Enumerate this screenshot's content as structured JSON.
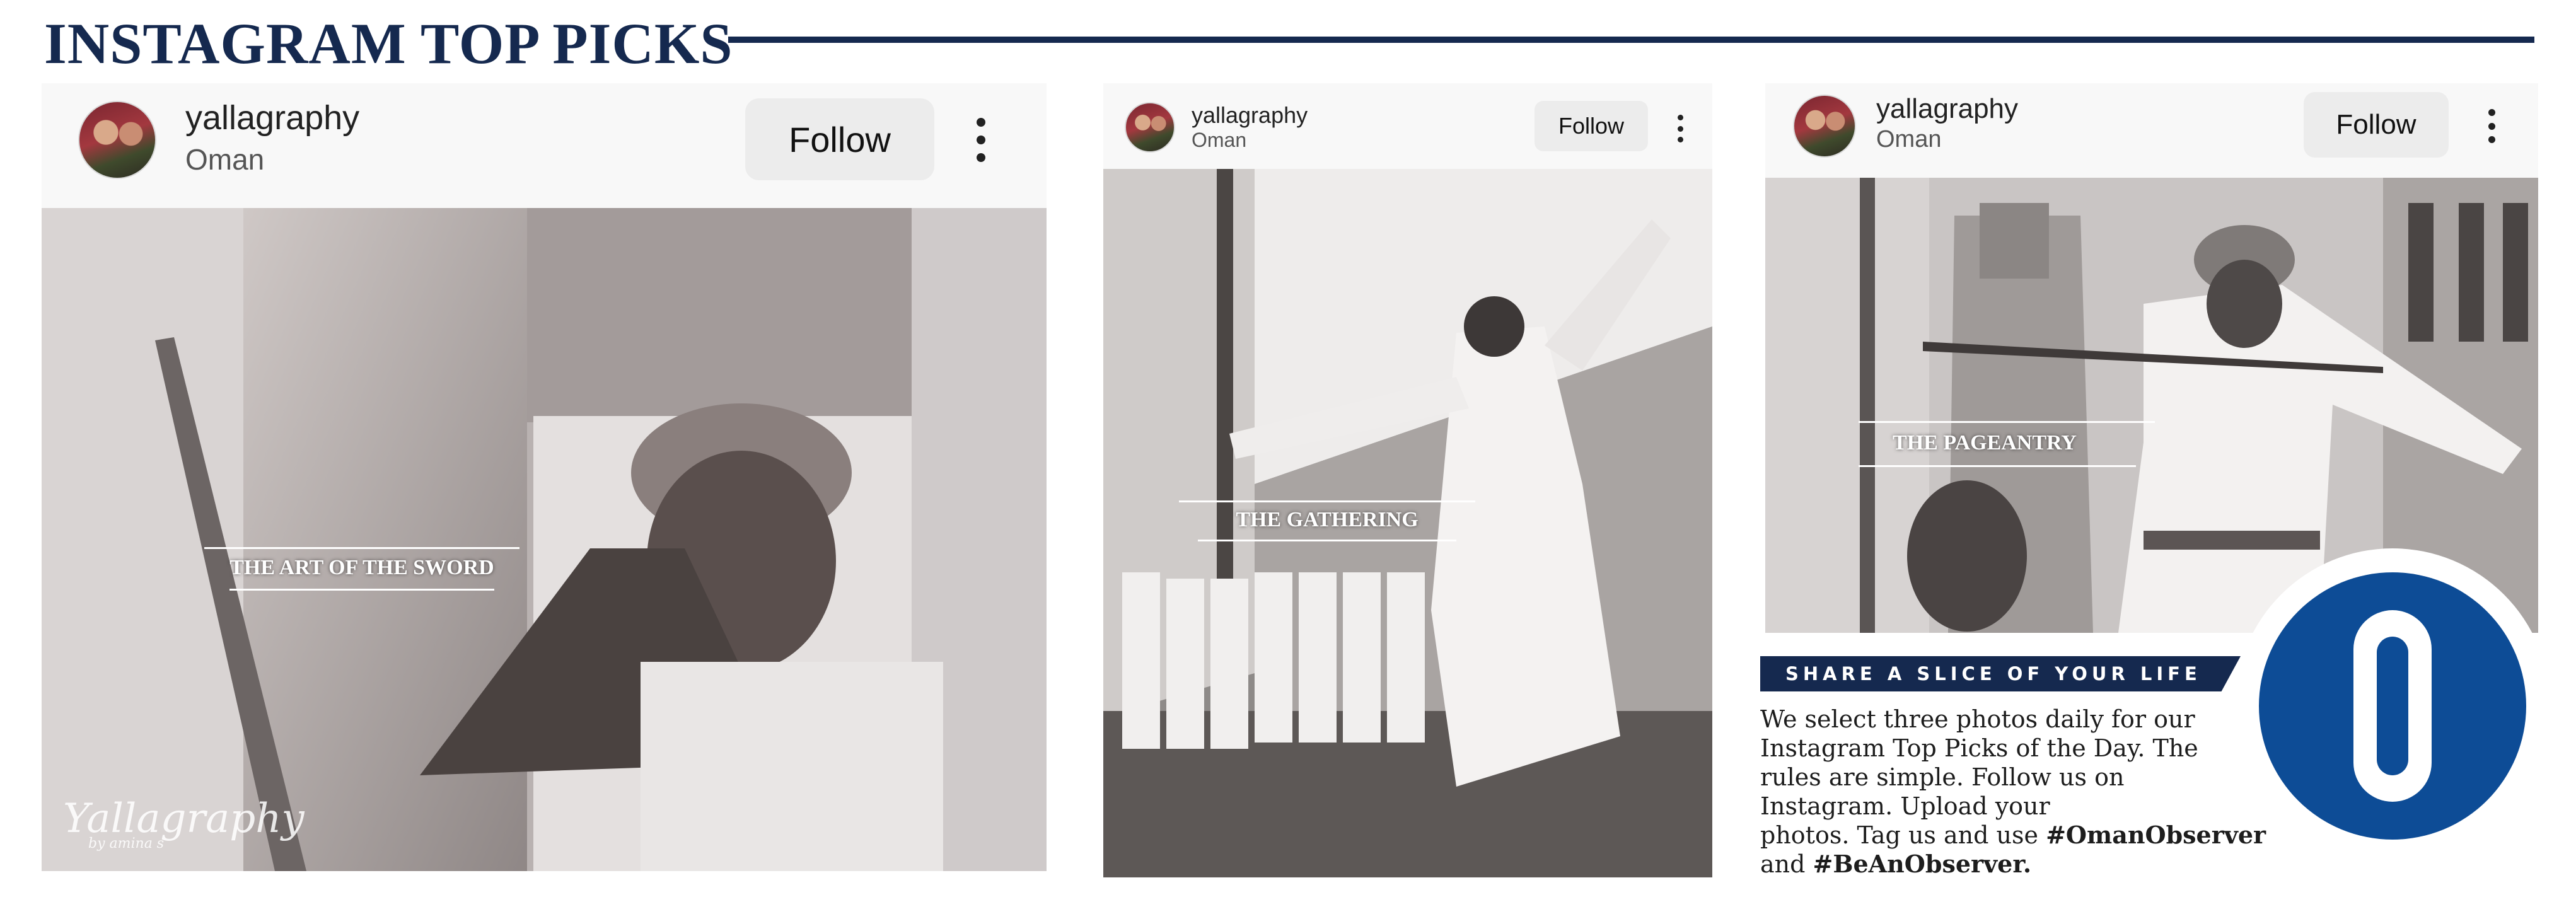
{
  "header": {
    "title": "INSTAGRAM TOP PICKS"
  },
  "posts": [
    {
      "username": "yallagraphy",
      "location": "Oman",
      "follow_label": "Follow",
      "photo_caption": "THE ART OF THE SWORD",
      "watermark": "Yallagraphy",
      "watermark_sub": "by amina s"
    },
    {
      "username": "yallagraphy",
      "location": "Oman",
      "follow_label": "Follow",
      "photo_caption": "THE GATHERING"
    },
    {
      "username": "yallagraphy",
      "location": "Oman",
      "follow_label": "Follow",
      "photo_caption": "THE PAGEANTRY"
    }
  ],
  "info": {
    "banner": "SHARE A SLICE OF YOUR LIFE",
    "lines": [
      "We select three photos daily for our",
      "Instagram Top Picks of the Day. The",
      "rules are simple. Follow us on",
      "Instagram. Upload your"
    ],
    "line5_text": "photos. Tag us and use ",
    "hashtag1": "#OmanObserver",
    "line6_text": "and ",
    "hashtag2": "#BeAnObserver."
  },
  "colors": {
    "navy": "#15294f",
    "observer_blue": "#0d4c96",
    "follow_bg": "#ececec"
  },
  "icons": [
    "more-vertical-icon",
    "observer-logo-icon"
  ]
}
